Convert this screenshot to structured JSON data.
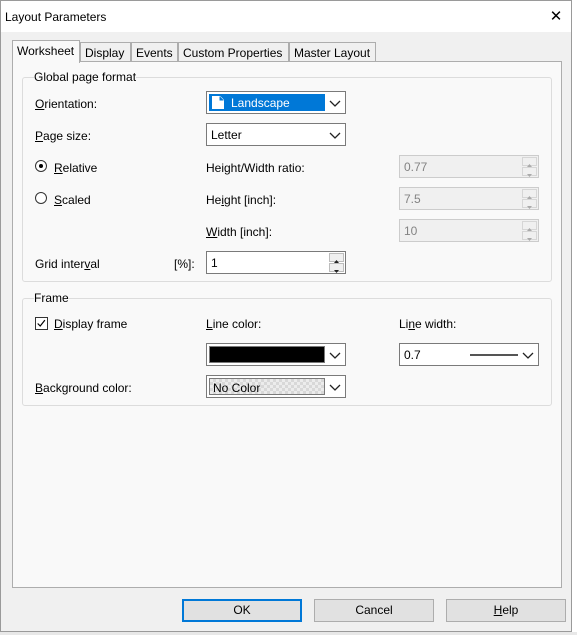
{
  "window": {
    "title": "Layout Parameters",
    "close_glyph": "✕"
  },
  "tabs": [
    {
      "label": "Worksheet",
      "active": true
    },
    {
      "label": "Display",
      "active": false
    },
    {
      "label": "Events",
      "active": false
    },
    {
      "label": "Custom Properties",
      "active": false
    },
    {
      "label": "Master Layout",
      "active": false
    }
  ],
  "global_format": {
    "title": "Global page format",
    "orientation_label": "Orientation:",
    "orientation_value": "Landscape",
    "page_size_label": "Page size:",
    "page_size_value": "Letter",
    "relative_label": "Relative",
    "relative_selected": true,
    "scaled_label": "Scaled",
    "scaled_selected": false,
    "ratio_label": "Height/Width ratio:",
    "ratio_value": "0.77",
    "height_label": "Height [inch]:",
    "height_value": "7.5",
    "width_label": "Width [inch]:",
    "width_value": "10",
    "grid_label": "Grid interval",
    "grid_unit": "[%]:",
    "grid_value": "1"
  },
  "frame": {
    "title": "Frame",
    "display_frame_label": "Display frame",
    "display_frame_checked": true,
    "line_color_label": "Line color:",
    "line_color": "#000000",
    "line_width_label": "Line width:",
    "line_width_value": "0.7",
    "background_label": "Background color:",
    "background_value": "No Color"
  },
  "buttons": {
    "ok": "OK",
    "cancel": "Cancel",
    "help": "Help"
  },
  "colors": {
    "accent": "#0078d7",
    "panel": "#f9f9f9",
    "window": "#f0f0f0"
  }
}
